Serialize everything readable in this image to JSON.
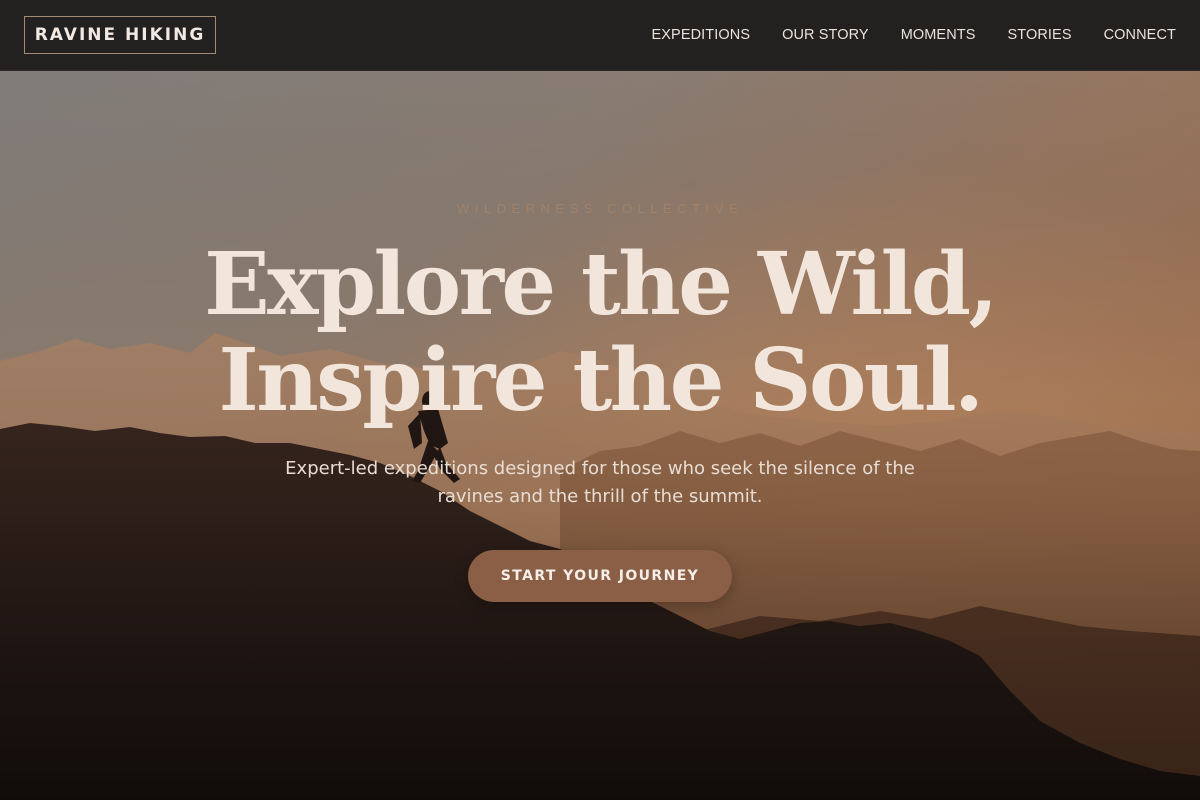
{
  "brand": {
    "logo_text": "RAVINE HIKING"
  },
  "nav": {
    "items": [
      {
        "label": "EXPEDITIONS"
      },
      {
        "label": "OUR STORY"
      },
      {
        "label": "MOMENTS"
      },
      {
        "label": "STORIES"
      },
      {
        "label": "CONNECT"
      }
    ]
  },
  "hero": {
    "eyebrow": "WILDERNESS COLLECTIVE",
    "headline_line1": "Explore the Wild,",
    "headline_line2": "Inspire the Soul.",
    "subheadline": "Expert-led expeditions designed for those who seek the silence of the ravines and the thrill of the summit.",
    "cta_label": "START YOUR JOURNEY"
  },
  "colors": {
    "navbar_bg": "#232120",
    "accent": "#8a5f45",
    "headline_text": "#f2e6dc",
    "logo_border": "#a38a72"
  },
  "icons": [
    "hiker-silhouette",
    "mountain-range"
  ]
}
